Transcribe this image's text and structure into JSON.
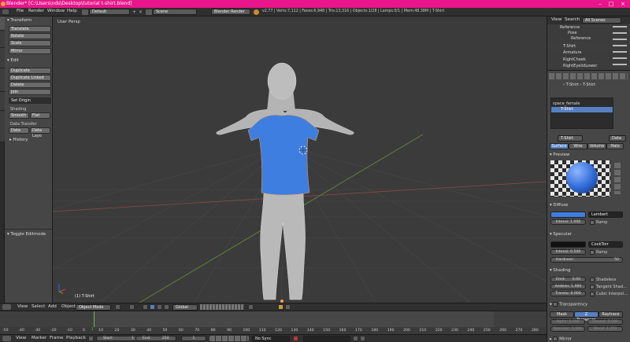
{
  "window": {
    "title": "Blender* [C:\\Users\\nds\\Desktop\\tutorial t-shirt.blend]"
  },
  "topbar": {
    "menus": [
      "File",
      "Render",
      "Window",
      "Help"
    ],
    "screen_layout": "Default",
    "scene": "Scene",
    "render_engine": "Blender Render",
    "stats": "v2.77 | Verts:7,112 | Faces:6,948 | Tris:13,316 | Objects:1/28 | Lamps:0/1 | Mem:48.38M | T-Shirt"
  },
  "toolshelf": {
    "tabs": [
      "Tools",
      "Create",
      "Relations",
      "Animation",
      "Physics",
      "Grease Pencil"
    ],
    "transform": {
      "title": "Transform",
      "buttons": [
        "Translate",
        "Rotate",
        "Scale",
        "Mirror"
      ]
    },
    "edit": {
      "title": "Edit",
      "buttons": [
        "Duplicate",
        "Duplicate Linked",
        "Delete",
        "Join"
      ],
      "set_origin": "Set Origin"
    },
    "shading": {
      "title": "Shading",
      "smooth": "Smooth",
      "flat": "Flat"
    },
    "data_transfer": {
      "title": "Data Transfer",
      "data": "Data",
      "data_layout": "Data Layo"
    },
    "history": "History",
    "toggle_editmode": "Toggle Editmode"
  },
  "viewport": {
    "label": "User Persp",
    "object_label": "(1) T-Shirt"
  },
  "view3d_header": {
    "menus": [
      "View",
      "Select",
      "Add",
      "Object"
    ],
    "mode": "Object Mode",
    "orientation": "Global"
  },
  "timeline": {
    "ticks": [
      "-50",
      "-40",
      "-30",
      "-20",
      "-10",
      "0",
      "10",
      "20",
      "30",
      "40",
      "50",
      "60",
      "70",
      "80",
      "90",
      "100",
      "110",
      "120",
      "130",
      "140",
      "150",
      "160",
      "170",
      "180",
      "190",
      "200",
      "210",
      "220",
      "230",
      "240",
      "250",
      "260",
      "270",
      "280"
    ],
    "current_frame_marker": "1"
  },
  "timeline_header": {
    "menus": [
      "View",
      "Marker",
      "Frame",
      "Playback"
    ],
    "start_label": "Start:",
    "start": "1",
    "end_label": "End:",
    "end": "250",
    "current": "1",
    "sync": "No Sync"
  },
  "outliner": {
    "menus": [
      "View",
      "Search"
    ],
    "filter": "All Scenes",
    "items": [
      "Reference",
      "Pose",
      "Reference",
      "T-Shirt",
      "Armature",
      "RightCheek",
      "RightEyelidLower"
    ]
  },
  "properties": {
    "breadcrumb": [
      "T-Shirt",
      "T-Shirt"
    ],
    "material_slots": [
      "space_female",
      "T-Shirt"
    ],
    "material_name": "T-Shirt",
    "data_label": "Data",
    "tabs": [
      "Surface",
      "Wire",
      "Volume",
      "Halo"
    ],
    "preview": "Preview",
    "diffuse": {
      "title": "Diffuse",
      "shader": "Lambert",
      "intensity": "Intensi: 1.000",
      "ramp": "Ramp",
      "color": "#3e7ee0"
    },
    "specular": {
      "title": "Specular",
      "shader": "CookTorr",
      "intensity": "Intensi: 0.500",
      "ramp": "Ramp",
      "hardness": "Hardness:",
      "hardness_value": "50"
    },
    "shading": {
      "title": "Shading",
      "emit": "Emit:",
      "emit_value": "0.00",
      "ambient": "Ambien: 1.000",
      "translu": "Translu: 0.000",
      "shadeless": "Shadeless",
      "tangent": "Tangent Shad...",
      "cubic": "Cubic Interpol..."
    },
    "transparency": {
      "title": "Transparency",
      "modes": [
        "Mask",
        "Z Transpare",
        "Raytrace"
      ],
      "alpha": "Alpha: 1.000",
      "fresnel": "Fresnel: 0.000",
      "specular": "Specular: 1.000",
      "blend": "Blend: 1.250"
    },
    "mirror": "Mirror"
  }
}
